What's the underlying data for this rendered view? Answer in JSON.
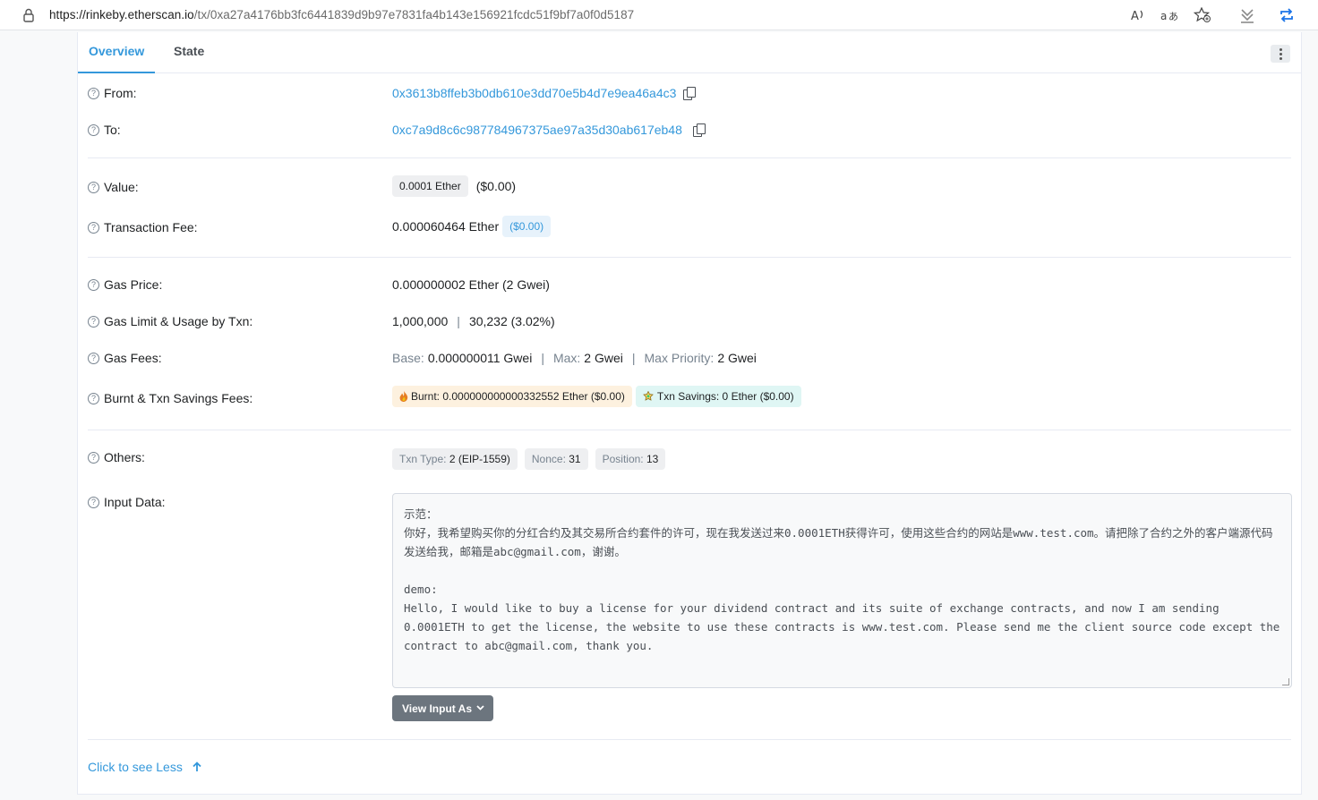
{
  "browser": {
    "url_host": "https://rinkeby.etherscan.io",
    "url_path": "/tx/0xa27a4176bb3fc6441839d9b97e7831fa4b143e156921fcdc51f9bf7a0f0d5187"
  },
  "tabs": [
    {
      "label": "Overview",
      "active": true
    },
    {
      "label": "State",
      "active": false
    }
  ],
  "rows": {
    "from": {
      "label": "From:",
      "value": "0x3613b8ffeb3b0db610e3dd70e5b4d7e9ea46a4c3"
    },
    "to": {
      "label": "To:",
      "value": "0xc7a9d8c6c987784967375ae97a35d30ab617eb48"
    },
    "value": {
      "label": "Value:",
      "badge": "0.0001 Ether",
      "usd": "($0.00)"
    },
    "fee": {
      "label": "Transaction Fee:",
      "value": "0.000060464 Ether",
      "usd": "($0.00)"
    },
    "gas_price": {
      "label": "Gas Price:",
      "value": "0.000000002 Ether (2 Gwei)"
    },
    "gas_limit": {
      "label": "Gas Limit & Usage by Txn:",
      "limit": "1,000,000",
      "sep": "|",
      "usage": "30,232 (3.02%)"
    },
    "gas_fees": {
      "label": "Gas Fees:",
      "base_label": "Base:",
      "base_value": "0.000000011 Gwei",
      "max_label": "Max:",
      "max_value": "2 Gwei",
      "priority_label": "Max Priority:",
      "priority_value": "2 Gwei"
    },
    "burnt": {
      "label": "Burnt & Txn Savings Fees:",
      "burnt_text": "Burnt: 0.000000000000332552 Ether ($0.00)",
      "savings_text": "Txn Savings: 0 Ether ($0.00)"
    },
    "others": {
      "label": "Others:",
      "txn_type_label": "Txn Type:",
      "txn_type_value": "2 (EIP-1559)",
      "nonce_label": "Nonce:",
      "nonce_value": "31",
      "position_label": "Position:",
      "position_value": "13"
    },
    "input": {
      "label": "Input Data:",
      "text": "示范：\n你好，我希望购买你的分红合约及其交易所合约套件的许可，现在我发送过来0.0001ETH获得许可，使用这些合约的网站是www.test.com。请把除了合约之外的客户端源代码发送给我，邮箱是abc@gmail.com，谢谢。\n\ndemo:\nHello, I would like to buy a license for your dividend contract and its suite of exchange contracts, and now I am sending 0.0001ETH to get the license, the website to use these contracts is www.test.com. Please send me the client source code except the contract to abc@gmail.com, thank you."
    }
  },
  "view_input_button": "View Input As",
  "see_less": "Click to see Less",
  "help_glyph": "?"
}
